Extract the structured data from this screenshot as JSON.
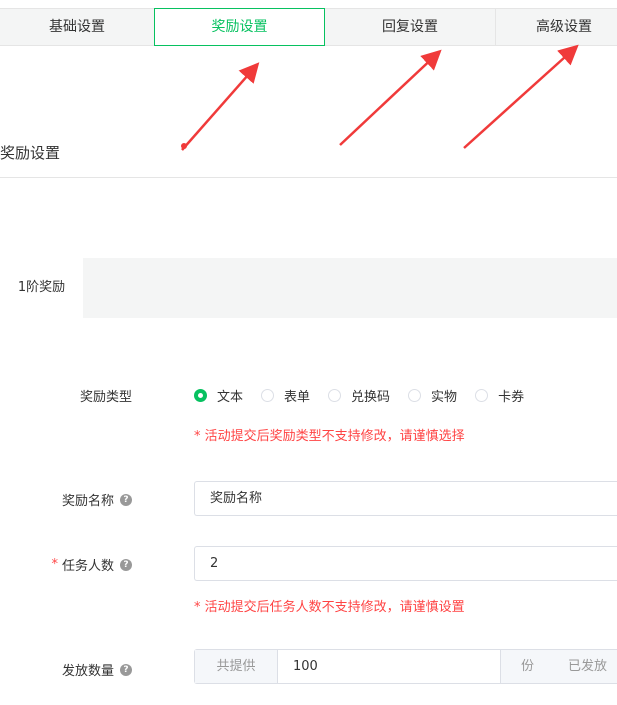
{
  "tabs": [
    "基础设置",
    "奖励设置",
    "回复设置",
    "高级设置"
  ],
  "section_title": "奖励设置",
  "stage_tab": "1阶奖励",
  "form": {
    "reward_type": {
      "label": "奖励类型",
      "options": [
        "文本",
        "表单",
        "兑换码",
        "实物",
        "卡券"
      ],
      "selected": "文本",
      "hint": "* 活动提交后奖励类型不支持修改，请谨慎选择"
    },
    "reward_name": {
      "label": "奖励名称",
      "value": "奖励名称"
    },
    "task_people": {
      "required": "*",
      "label": "任务人数",
      "value": "2",
      "hint": "* 活动提交后任务人数不支持修改，请谨慎设置"
    },
    "quantity": {
      "label": "发放数量",
      "prefix": "共提供",
      "value": "100",
      "suffix": "份",
      "issued": "已发放"
    }
  },
  "help_icon": "?",
  "colors": {
    "accent": "#07c160",
    "warn": "#ff4444",
    "annotation": "#f03a3a"
  }
}
